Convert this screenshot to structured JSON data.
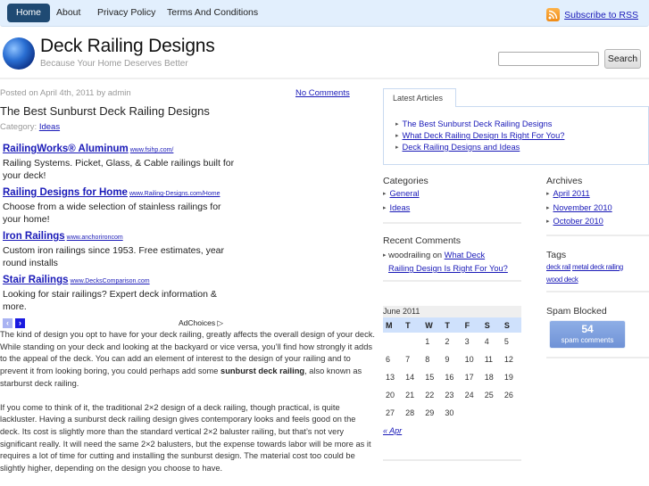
{
  "nav": {
    "items": [
      {
        "label": "Home",
        "active": true
      },
      {
        "label": "About",
        "active": false
      },
      {
        "label": "Privacy Policy",
        "active": false
      },
      {
        "label": "Terms And Conditions",
        "active": false
      }
    ],
    "rss_label": "Subscribe to RSS"
  },
  "header": {
    "logo_icon": "globe-icon",
    "title": "Deck Railing Designs",
    "tagline": "Because Your Home Deserves Better",
    "search": {
      "value": "",
      "placeholder": "",
      "button_label": "Search"
    }
  },
  "post": {
    "meta": "Posted on April 4th, 2011 by admin",
    "comments_link": "No Comments",
    "title": "The Best Sunburst Deck Railing Designs",
    "category_label": "Category:",
    "category": "Ideas",
    "ads": [
      {
        "title": "RailingWorks® Aluminum",
        "url": "www.fsihp.com/",
        "desc": "Railing Systems. Picket, Glass, & Cable railings built for your deck!"
      },
      {
        "title": "Railing Designs for Home",
        "url": "www.Railing-Designs.com/Home",
        "desc": "Choose from a wide selection of stainless railings for your home!"
      },
      {
        "title": "Iron Railings",
        "url": "www.anchorironcom",
        "desc": "Custom iron railings since 1953. Free estimates, year round installs"
      },
      {
        "title": "Stair Railings",
        "url": "www.DecksComparison.com",
        "desc": "Looking for stair railings? Expert deck information & more."
      }
    ],
    "ad_prev": "‹",
    "ad_next": "›",
    "adchoices": "AdChoices ▷",
    "body": {
      "p1_before": "The kind of design you opt to have for your deck railing, greatly affects the overall design of your deck. While standing on your deck and looking at the backyard or vice versa, you’ll find how strongly it adds to the appeal of the deck. You can add an element of interest to the design of your railing and to prevent it from looking boring, you could perhaps add some ",
      "p1_bold": "sunburst deck railing",
      "p1_after": ", also known as starburst deck railing.",
      "p2": "If you come to think of it, the traditional 2×2 design of a deck railing, though practical, is quite lackluster. Having a sunburst deck railing design gives contemporary looks and feels good on the deck. Its cost is slightly more than the standard vertical 2×2 baluster railing, but that’s not very significant really. It will need the same 2×2 balusters, but the expense towards labor will be more as it requires a lot of time for cutting and installing the sunburst design. The material cost too could be slightly higher, depending on the design you choose to have."
    }
  },
  "sidebar": {
    "latest": {
      "tab_label": "Latest Articles",
      "items": [
        "The Best Sunburst Deck Railing Designs",
        "What Deck Railing Design Is Right For You?",
        "Deck Railing Designs and Ideas"
      ]
    },
    "categories": {
      "title": "Categories",
      "items": [
        "General",
        "Ideas"
      ]
    },
    "archives": {
      "title": "Archives",
      "items": [
        "April 2011",
        "November 2010",
        "October 2010"
      ]
    },
    "recent_comments": {
      "title": "Recent Comments",
      "author": "woodrailing",
      "on": "on",
      "link_part1": "What Deck",
      "link_part2": "Railing Design Is Right For You?"
    },
    "tags": {
      "title": "Tags",
      "items": [
        "deck rail",
        "metal deck railing",
        "wood deck"
      ]
    },
    "calendar": {
      "caption": "June 2011",
      "weekdays": [
        "M",
        "T",
        "W",
        "T",
        "F",
        "S",
        "S"
      ],
      "weeks": [
        [
          "",
          "",
          "1",
          "2",
          "3",
          "4",
          "5"
        ],
        [
          "6",
          "7",
          "8",
          "9",
          "10",
          "11",
          "12"
        ],
        [
          "13",
          "14",
          "15",
          "16",
          "17",
          "18",
          "19"
        ],
        [
          "20",
          "21",
          "22",
          "23",
          "24",
          "25",
          "26"
        ],
        [
          "27",
          "28",
          "29",
          "30",
          "",
          "",
          ""
        ]
      ],
      "prev_link": "« Apr"
    },
    "spam": {
      "title": "Spam Blocked",
      "count": "54",
      "label": "spam comments"
    }
  },
  "colors": {
    "link": "#1a1ab8",
    "nav_bg": "#e2effd",
    "nav_active": "#1f4a73",
    "calendar_header": "#cfe1fc",
    "spam_box": "#7f9fde"
  }
}
